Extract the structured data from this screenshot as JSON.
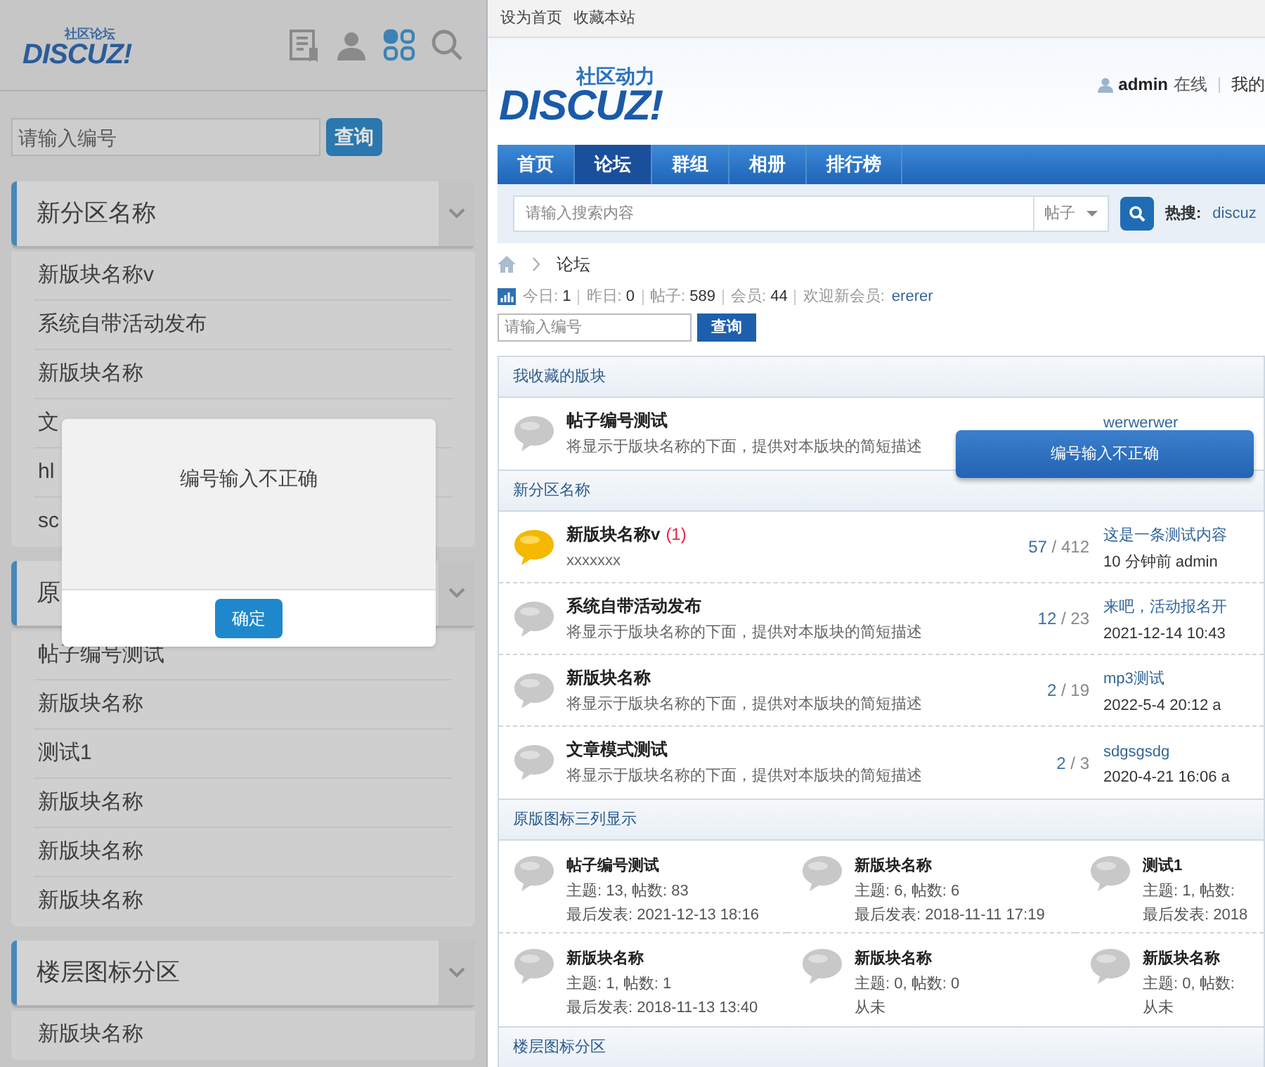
{
  "mobile": {
    "logo": {
      "tagline": "社区论坛",
      "wordmark": "DISCUZ!"
    },
    "header_icons": [
      {
        "selected": false
      },
      {
        "selected": false
      },
      {
        "selected": true
      },
      {
        "selected": false
      }
    ],
    "search": {
      "placeholder": "请输入编号",
      "button": "查询"
    },
    "sections": [
      {
        "title": "新分区名称",
        "items": [
          "新版块名称v",
          "系统自带活动发布",
          "新版块名称",
          "文",
          "hl",
          "sc"
        ]
      },
      {
        "title": "原",
        "items": [
          "帖子编号测试",
          "新版块名称",
          "测试1",
          "新版块名称",
          "新版块名称",
          "新版块名称"
        ]
      },
      {
        "title": "楼层图标分区",
        "items": [
          "新版块名称"
        ]
      }
    ],
    "dialog": {
      "message": "编号输入不正确",
      "button": "确定"
    }
  },
  "desktop": {
    "top_links": [
      "设为首页",
      "收藏本站"
    ],
    "logo": {
      "tagline": "社区动力",
      "wordmark": "DISCUZ!"
    },
    "user": {
      "name": "admin",
      "status": "在线",
      "link": "我的"
    },
    "nav": [
      {
        "label": "首页",
        "selected": false
      },
      {
        "label": "论坛",
        "selected": true
      },
      {
        "label": "群组",
        "selected": false
      },
      {
        "label": "相册",
        "selected": false
      },
      {
        "label": "排行榜",
        "selected": false
      }
    ],
    "search": {
      "placeholder": "请输入搜索内容",
      "scope": "帖子",
      "hot_label": "热搜:",
      "hot_terms": [
        "discuz"
      ]
    },
    "breadcrumb": [
      "论坛"
    ],
    "stats": [
      {
        "label": "今日:",
        "value": "1"
      },
      {
        "label": "昨日:",
        "value": "0"
      },
      {
        "label": "帖子:",
        "value": "589"
      },
      {
        "label": "会员:",
        "value": "44"
      }
    ],
    "welcome": {
      "label": "欢迎新会员:",
      "member": "ererer"
    },
    "number_search": {
      "placeholder": "请输入编号",
      "button": "查询"
    },
    "categories": [
      {
        "title": "我收藏的版块",
        "kind": "list",
        "forums": [
          {
            "name": "帖子编号测试",
            "description": "将显示于版块名称的下面，提供对本版块的简短描述",
            "new": false,
            "last_post": "werwerwer"
          }
        ]
      },
      {
        "title": "新分区名称",
        "kind": "list",
        "forums": [
          {
            "name": "新版块名称v",
            "today": "(1)",
            "description": "xxxxxxx",
            "new": true,
            "topics": "57",
            "posts": "/ 412",
            "last_post": "这是一条测试内容",
            "last_time": "10 分钟前 admin"
          },
          {
            "name": "系统自带活动发布",
            "description": "将显示于版块名称的下面，提供对本版块的简短描述",
            "new": false,
            "topics": "12",
            "posts": "/ 23",
            "last_post": "来吧，活动报名开",
            "last_time": "2021-12-14 10:43"
          },
          {
            "name": "新版块名称",
            "description": "将显示于版块名称的下面，提供对本版块的简短描述",
            "new": false,
            "topics": "2",
            "posts": "/ 19",
            "last_post": "mp3测试",
            "last_time": "2022-5-4 20:12 a"
          },
          {
            "name": "文章模式测试",
            "description": "将显示于版块名称的下面，提供对本版块的简短描述",
            "new": false,
            "topics": "2",
            "posts": "/ 3",
            "last_post": "sdgsgsdg",
            "last_time": "2020-4-21 16:06 a"
          }
        ]
      },
      {
        "title": "原版图标三列显示",
        "kind": "grid",
        "forums": [
          {
            "name": "帖子编号测试",
            "counts": "主题: 13, 帖数: 83",
            "last": "最后发表: 2021-12-13 18:16"
          },
          {
            "name": "新版块名称",
            "counts": "主题: 6, 帖数: 6",
            "last": "最后发表: 2018-11-11 17:19"
          },
          {
            "name": "测试1",
            "counts": "主题: 1, 帖数:",
            "last": "最后发表: 2018"
          },
          {
            "name": "新版块名称",
            "counts": "主题: 1, 帖数: 1",
            "last": "最后发表: 2018-11-13 13:40"
          },
          {
            "name": "新版块名称",
            "counts": "主题: 0, 帖数: 0",
            "last": "从未"
          },
          {
            "name": "新版块名称",
            "counts": "主题: 0, 帖数:",
            "last": "从未"
          }
        ]
      },
      {
        "title": "楼层图标分区"
      }
    ],
    "toast": {
      "message": "编号输入不正确"
    }
  }
}
